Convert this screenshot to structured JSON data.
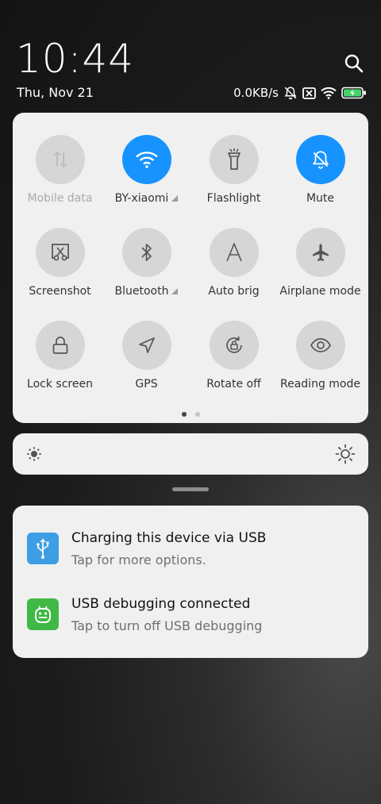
{
  "status_bar": {
    "time": "10:44",
    "date": "Thu, Nov 21",
    "speed": "0.0KB/s"
  },
  "icons": {
    "search": "search-icon",
    "mute_status": "bell-off-icon",
    "no_sim": "no-sim-icon",
    "wifi": "wifi-icon",
    "battery": "battery-charging-icon"
  },
  "colors": {
    "accent": "#1793ff",
    "panel": "#f0f0f0",
    "tile_off": "#d6d6d6",
    "usb_icon_bg": "#3d9ee6",
    "debug_icon_bg": "#3fb846",
    "battery_fill": "#46d36b"
  },
  "quick_settings": {
    "tiles": [
      {
        "label": "Mobile data",
        "icon": "mobile-data-icon",
        "active": false,
        "disabled": true
      },
      {
        "label": "BY-xiaomi",
        "icon": "wifi-icon",
        "active": true,
        "disabled": false
      },
      {
        "label": "Flashlight",
        "icon": "flashlight-icon",
        "active": false,
        "disabled": false
      },
      {
        "label": "Mute",
        "icon": "bell-off-icon",
        "active": true,
        "disabled": false
      },
      {
        "label": "Screenshot",
        "icon": "screenshot-icon",
        "active": false,
        "disabled": false
      },
      {
        "label": "Bluetooth",
        "icon": "bluetooth-icon",
        "active": false,
        "disabled": false
      },
      {
        "label": "Auto brig",
        "icon": "auto-brightness-icon",
        "active": false,
        "disabled": false
      },
      {
        "label": "Airplane mode",
        "icon": "airplane-icon",
        "active": false,
        "disabled": false
      },
      {
        "label": "Lock screen",
        "icon": "lock-icon",
        "active": false,
        "disabled": false
      },
      {
        "label": "GPS",
        "icon": "location-arrow-icon",
        "active": false,
        "disabled": false
      },
      {
        "label": "Rotate off",
        "icon": "rotate-lock-icon",
        "active": false,
        "disabled": false
      },
      {
        "label": "Reading mode",
        "icon": "eye-icon",
        "active": false,
        "disabled": false
      }
    ],
    "page_indicator": {
      "pages": 2,
      "current": 1
    }
  },
  "brightness": {
    "low_icon": "brightness-low-icon",
    "high_icon": "brightness-high-icon"
  },
  "notifications": [
    {
      "title": "Charging this device via USB",
      "subtitle": "Tap for more options.",
      "icon": "usb-icon"
    },
    {
      "title": "USB debugging connected",
      "subtitle": "Tap to turn off USB debugging",
      "icon": "android-debug-icon"
    }
  ]
}
